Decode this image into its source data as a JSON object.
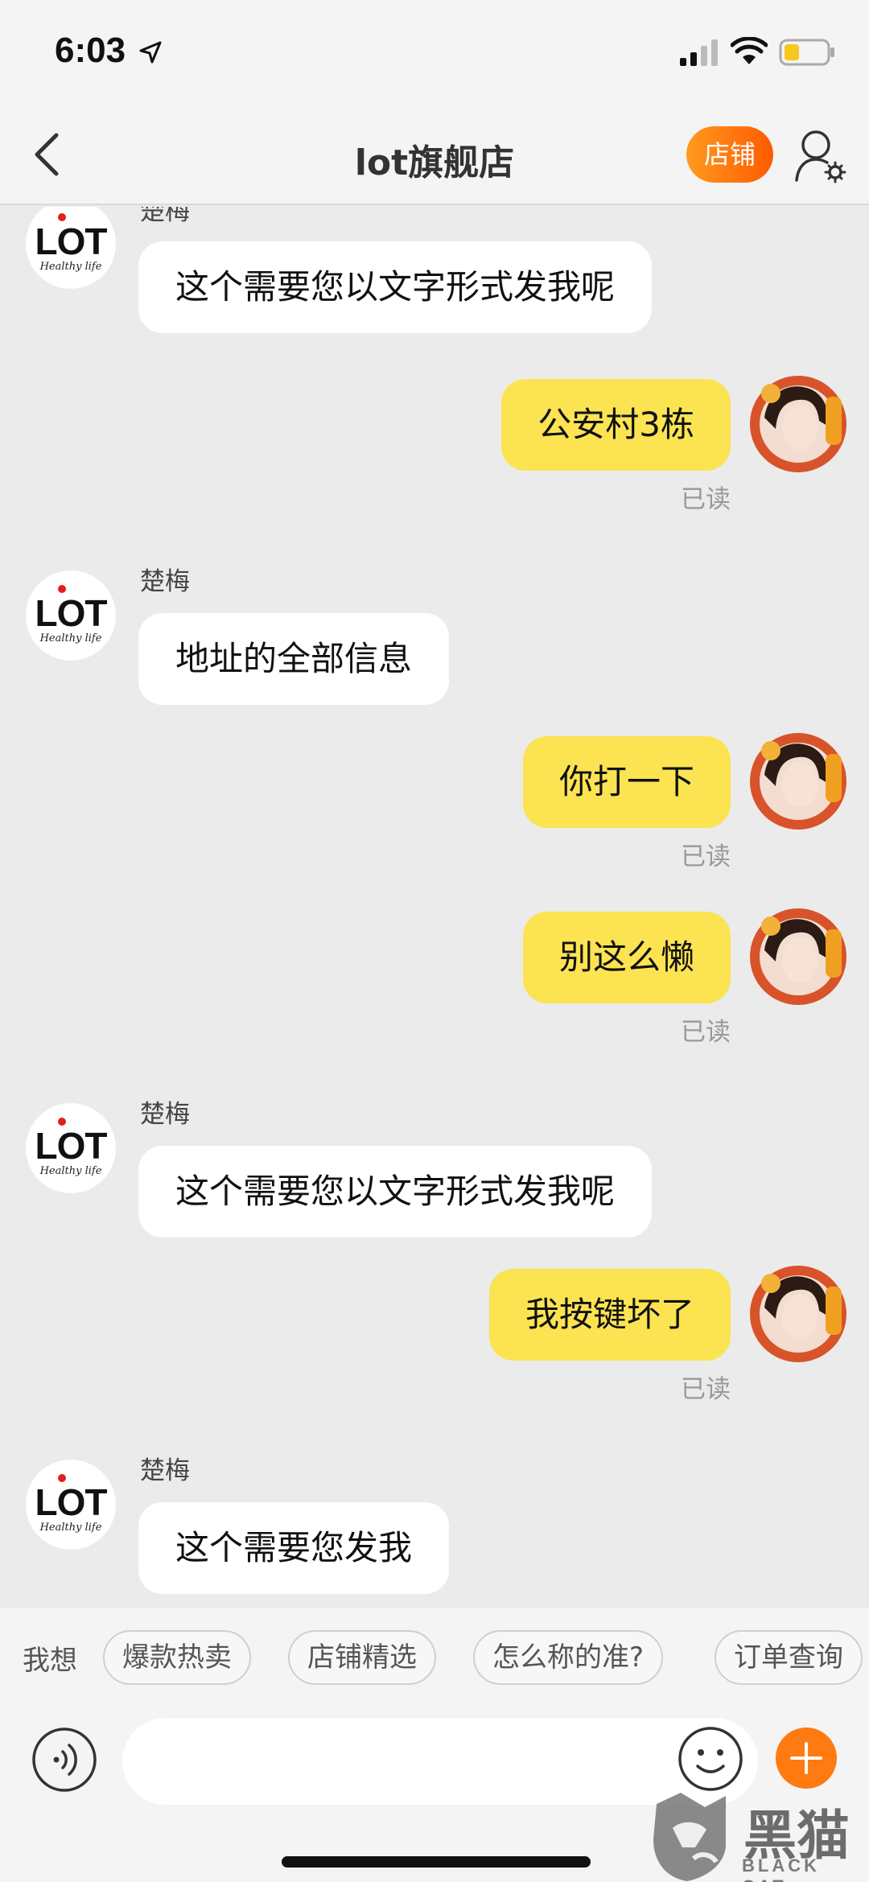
{
  "status_bar": {
    "time": "6:03"
  },
  "nav": {
    "title": "lot旗舰店",
    "shop_button": "店铺"
  },
  "shop_avatar": {
    "logo": "LOT",
    "tagline": "Healthy life"
  },
  "messages": [
    {
      "side": "in",
      "sender": "楚梅",
      "text": "这个需要您以文字形式发我呢"
    },
    {
      "side": "out",
      "text": "公安村3栋",
      "status": "已读"
    },
    {
      "side": "in",
      "sender": "楚梅",
      "text": "地址的全部信息"
    },
    {
      "side": "out",
      "text": "你打一下",
      "status": "已读"
    },
    {
      "side": "out",
      "text": "别这么懒",
      "status": "已读"
    },
    {
      "side": "in",
      "sender": "楚梅",
      "text": "这个需要您以文字形式发我呢"
    },
    {
      "side": "out",
      "text": "我按键坏了",
      "status": "已读"
    },
    {
      "side": "in",
      "sender": "楚梅",
      "text": "这个需要您发我"
    }
  ],
  "quick_bar": {
    "prefix": "我想",
    "chips": [
      "爆款热卖",
      "店铺精选",
      "怎么称的准?",
      "订单查询"
    ]
  },
  "input": {
    "placeholder": ""
  },
  "icons": {
    "back": "chevron-left-icon",
    "user_settings": "user-gear-icon",
    "voice": "voice-icon",
    "emoji": "smiley-icon",
    "plus": "plus-icon"
  },
  "colors": {
    "accent_orange": "#ff7a10",
    "out_bubble": "#fbe352",
    "in_bubble": "#ffffff",
    "chat_bg": "#ebebeb"
  },
  "watermark": {
    "text": "黑猫",
    "sub": "BLACK CAT"
  }
}
